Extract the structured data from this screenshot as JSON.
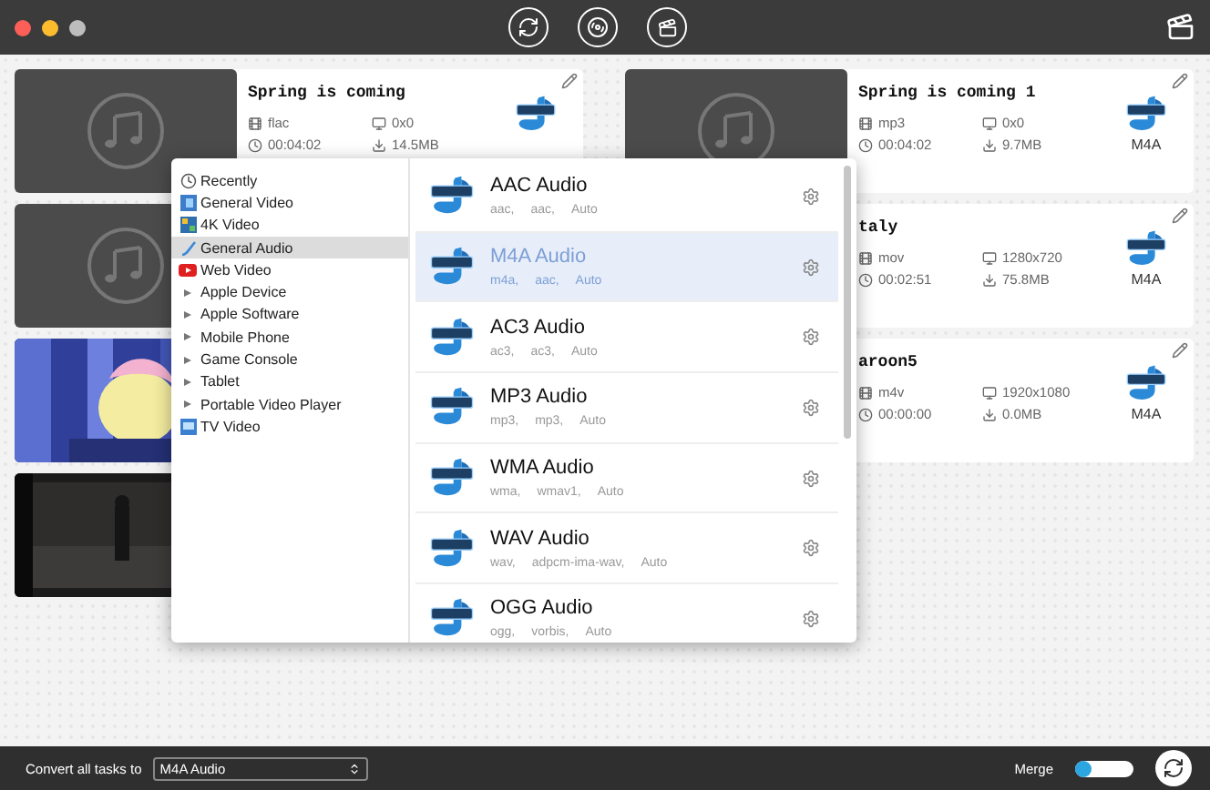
{
  "tasks": {
    "left": [
      {
        "kind": "music",
        "title": "Spring is coming",
        "meta": [
          {
            "kind": "format",
            "text": "flac"
          },
          {
            "kind": "resolution",
            "text": "0x0"
          },
          {
            "kind": "duration",
            "text": "00:04:02"
          },
          {
            "kind": "size",
            "text": "14.5MB"
          }
        ]
      },
      {
        "kind": "music"
      },
      {
        "kind": "picture"
      },
      {
        "kind": "video"
      }
    ],
    "right": [
      {
        "kind": "music",
        "title": "Spring is coming 1",
        "meta": [
          {
            "kind": "format",
            "text": "mp3"
          },
          {
            "kind": "resolution",
            "text": "0x0"
          },
          {
            "kind": "duration",
            "text": "00:04:02"
          },
          {
            "kind": "size",
            "text": "9.7MB"
          }
        ],
        "output": "M4A"
      },
      {
        "title": "taly",
        "meta": [
          {
            "kind": "format",
            "text": "mov"
          },
          {
            "kind": "resolution",
            "text": "1280x720"
          },
          {
            "kind": "duration",
            "text": "00:02:51"
          },
          {
            "kind": "size",
            "text": "75.8MB"
          }
        ],
        "output": "M4A"
      },
      {
        "title": "aroon5",
        "meta": [
          {
            "kind": "format",
            "text": "m4v"
          },
          {
            "kind": "resolution",
            "text": "1920x1080"
          },
          {
            "kind": "duration",
            "text": "00:00:00"
          },
          {
            "kind": "size",
            "text": "0.0MB"
          }
        ],
        "output": "M4A"
      }
    ]
  },
  "format_menu": {
    "categories": [
      {
        "kind": "recent",
        "label": "Recently",
        "selected": false
      },
      {
        "kind": "video",
        "label": "General Video",
        "selected": false
      },
      {
        "kind": "uhd",
        "label": "4K Video",
        "selected": false
      },
      {
        "kind": "audio",
        "label": "General Audio",
        "selected": true
      },
      {
        "kind": "web",
        "label": "Web Video",
        "selected": false
      },
      {
        "kind": "group",
        "label": "Apple Device",
        "selected": false
      },
      {
        "kind": "group",
        "label": "Apple Software",
        "selected": false
      },
      {
        "kind": "group",
        "label": "Mobile Phone",
        "selected": false
      },
      {
        "kind": "group",
        "label": "Game Console",
        "selected": false
      },
      {
        "kind": "group",
        "label": "Tablet",
        "selected": false
      },
      {
        "kind": "group",
        "label": "Portable Video Player",
        "selected": false
      },
      {
        "kind": "tv",
        "label": "TV Video",
        "selected": false
      }
    ],
    "formats": [
      {
        "name": "AAC Audio",
        "details": [
          "aac,",
          "aac,",
          "Auto"
        ],
        "selected": false
      },
      {
        "name": "M4A Audio",
        "details": [
          "m4a,",
          "aac,",
          "Auto"
        ],
        "selected": true
      },
      {
        "name": "AC3 Audio",
        "details": [
          "ac3,",
          "ac3,",
          "Auto"
        ],
        "selected": false
      },
      {
        "name": "MP3 Audio",
        "details": [
          "mp3,",
          "mp3,",
          "Auto"
        ],
        "selected": false
      },
      {
        "name": "WMA Audio",
        "details": [
          "wma,",
          "wmav1,",
          "Auto"
        ],
        "selected": false
      },
      {
        "name": "WAV Audio",
        "details": [
          "wav,",
          "adpcm-ima-wav,",
          "Auto"
        ],
        "selected": false
      },
      {
        "name": "OGG Audio",
        "details": [
          "ogg,",
          "vorbis,",
          "Auto"
        ],
        "selected": false
      }
    ]
  },
  "bottom_bar": {
    "label": "Convert all tasks to",
    "target": "M4A Audio",
    "merge_label": "Merge",
    "merge_on": false
  }
}
